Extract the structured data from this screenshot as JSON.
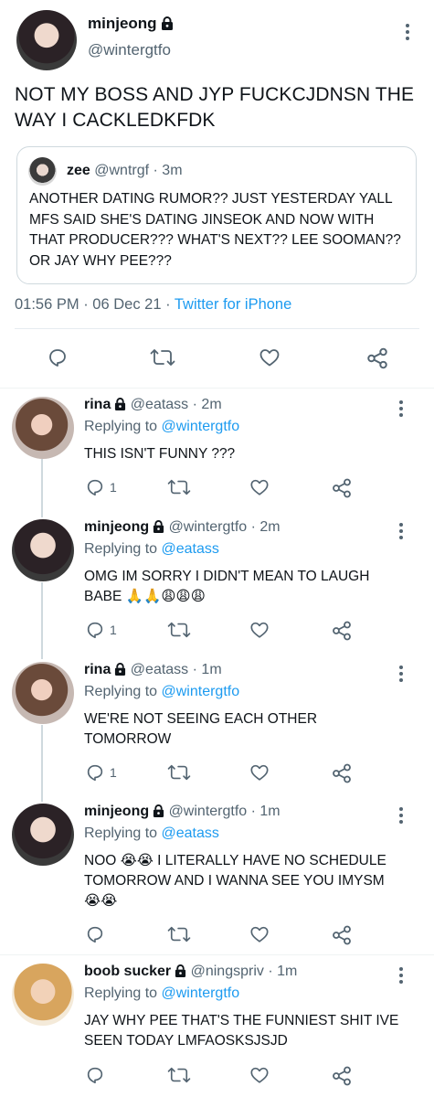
{
  "main_tweet": {
    "name": "minjeong",
    "handle": "@wintergtfo",
    "text": "NOT MY BOSS AND JYP FUCKCJDNSN THE WAY I CACKLEDKFDK",
    "quote": {
      "name": "zee",
      "handle": "@wntrgf",
      "time": "· 3m",
      "text": "ANOTHER DATING RUMOR?? JUST YESTERDAY YALL MFS SAID SHE'S DATING JINSEOK AND NOW WITH THAT PRODUCER??? WHAT'S NEXT?? LEE SOOMAN?? OR JAY WHY PEE???"
    },
    "time": "01:56 PM · 06 Dec 21 ·",
    "source": "Twitter for iPhone"
  },
  "replies": [
    {
      "name": "rina",
      "handle": "@eatass",
      "time": "· 2m",
      "replying_label": "Replying to",
      "replying_to": "@wintergtfo",
      "text": "THIS ISN'T FUNNY ???",
      "reply_count": "1",
      "avatar": "rina"
    },
    {
      "name": "minjeong",
      "handle": "@wintergtfo",
      "time": "· 2m",
      "replying_label": "Replying to",
      "replying_to": "@eatass",
      "text": "OMG IM SORRY I DIDN'T MEAN TO LAUGH BABE 🙏🙏😩😩😩",
      "reply_count": "1",
      "avatar": "minjeong"
    },
    {
      "name": "rina",
      "handle": "@eatass",
      "time": "· 1m",
      "replying_label": "Replying to",
      "replying_to": "@wintergtfo",
      "text": "WE'RE NOT SEEING EACH OTHER TOMORROW",
      "reply_count": "1",
      "avatar": "rina"
    },
    {
      "name": "minjeong",
      "handle": "@wintergtfo",
      "time": "· 1m",
      "replying_label": "Replying to",
      "replying_to": "@eatass",
      "text": "NOO 😭😭 I LITERALLY HAVE NO SCHEDULE TOMORROW AND I WANNA SEE YOU IMYSM 😭😭",
      "reply_count": "",
      "avatar": "minjeong"
    },
    {
      "name": "boob sucker",
      "handle": "@ningspriv",
      "time": "· 1m",
      "replying_label": "Replying to",
      "replying_to": "@wintergtfo",
      "text": "JAY WHY PEE THAT'S THE FUNNIEST SHIT IVE SEEN TODAY LMFAOSKSJSJD",
      "reply_count": "",
      "avatar": "boob"
    }
  ],
  "icons": {
    "reply": "reply-icon",
    "retweet": "retweet-icon",
    "like": "heart-icon",
    "share": "share-icon",
    "more": "more-vertical-icon",
    "lock": "lock-icon"
  },
  "colors": {
    "accent": "#1d9bf0",
    "secondary_text": "#536471",
    "text": "#0f1419",
    "border": "#cfd9de"
  }
}
